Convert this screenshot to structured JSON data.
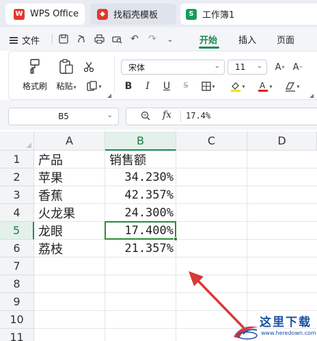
{
  "tabs": [
    {
      "label": "WPS Office",
      "icon": "wps-logo-icon"
    },
    {
      "label": "找稻壳模板",
      "icon": "docer-icon"
    },
    {
      "label": "工作簿1",
      "icon": "spreadsheet-icon",
      "icon_letter": "S"
    }
  ],
  "menu": {
    "file_label": "文件",
    "tabs": [
      "开始",
      "插入",
      "页面"
    ],
    "active_tab": "开始"
  },
  "ribbon": {
    "format_painter_label": "格式刷",
    "paste_label": "粘贴",
    "font_name": "宋体",
    "font_size": "11",
    "bold": "B",
    "italic": "I",
    "underline": "U",
    "font_color": "#e02020",
    "highlight_color": "#f2e200"
  },
  "formula_bar": {
    "cell_ref": "B5",
    "fx": "fx",
    "value": "17.4%"
  },
  "sheet": {
    "columns": [
      "A",
      "B",
      "C",
      "D"
    ],
    "selected_column": "B",
    "rows": [
      "1",
      "2",
      "3",
      "4",
      "5",
      "6",
      "7",
      "8",
      "9",
      "10",
      "11"
    ],
    "selected_row": "5",
    "header_row": {
      "a": "产品",
      "b": "销售额"
    },
    "data": [
      {
        "a": "苹果",
        "b": "34.230%"
      },
      {
        "a": "香蕉",
        "b": "42.357%"
      },
      {
        "a": "火龙果",
        "b": "24.300%"
      },
      {
        "a": "龙眼",
        "b": "17.400%"
      },
      {
        "a": "荔枝",
        "b": "21.357%"
      }
    ],
    "active_cell": "B5",
    "accent_color": "#1a8a52"
  },
  "annotation": {
    "arrow_color": "#d63a3a"
  },
  "watermark": {
    "text": "这里下载",
    "url": "www.heredown.com"
  }
}
